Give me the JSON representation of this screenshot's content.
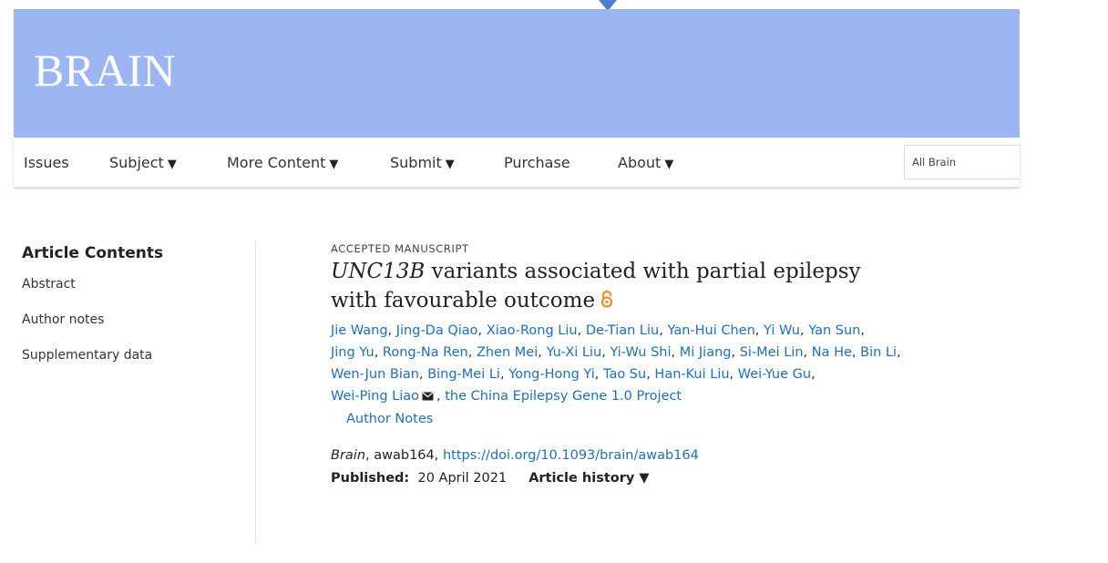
{
  "journal": {
    "logo_text": "BRAIN"
  },
  "nav": {
    "items": [
      {
        "label": "Issues",
        "has_dropdown": false
      },
      {
        "label": "Subject",
        "has_dropdown": true
      },
      {
        "label": "More Content",
        "has_dropdown": true
      },
      {
        "label": "Submit",
        "has_dropdown": true
      },
      {
        "label": "Purchase",
        "has_dropdown": false
      },
      {
        "label": "About",
        "has_dropdown": true
      }
    ],
    "dropdown_glyph": "▼",
    "search_scope": "All Brain"
  },
  "sidebar": {
    "title": "Article Contents",
    "items": [
      "Abstract",
      "Author notes",
      "Supplementary data"
    ]
  },
  "article": {
    "type_label": "ACCEPTED MANUSCRIPT",
    "title_gene": "UNC13B",
    "title_rest_line1": " variants associated with partial epilepsy",
    "title_line2": "with favourable outcome",
    "authors": [
      "Jie Wang",
      "Jing-Da Qiao",
      "Xiao-Rong Liu",
      "De-Tian Liu",
      "Yan-Hui Chen",
      "Yi Wu",
      "Yan Sun",
      "Jing Yu",
      "Rong-Na Ren",
      "Zhen Mei",
      "Yu-Xi Liu",
      "Yi-Wu Shi",
      "Mi Jiang",
      "Si-Mei Lin",
      "Na He",
      "Bin Li",
      "Wen-Jun Bian",
      "Bing-Mei Li",
      "Yong-Hong Yi",
      "Tao Su",
      "Han-Kui Liu",
      "Wei-Yue Gu",
      "Wei-Ping Liao",
      "the China Epilepsy Gene 1.0 Project"
    ],
    "author_notes_label": "Author Notes",
    "citation_journal": "Brain",
    "citation_id": ", awab164, ",
    "doi_url": "https://doi.org/10.1093/brain/awab164",
    "published_label": "Published:",
    "published_date": "20 April 2021",
    "history_label": "Article history ▼"
  },
  "colors": {
    "banner": "#9cb6f4",
    "link": "#1f6fb5",
    "open_access": "#f28c28"
  },
  "icons": {
    "open_access": "open-access-lock-icon",
    "corresponding_author": "envelope-icon"
  }
}
